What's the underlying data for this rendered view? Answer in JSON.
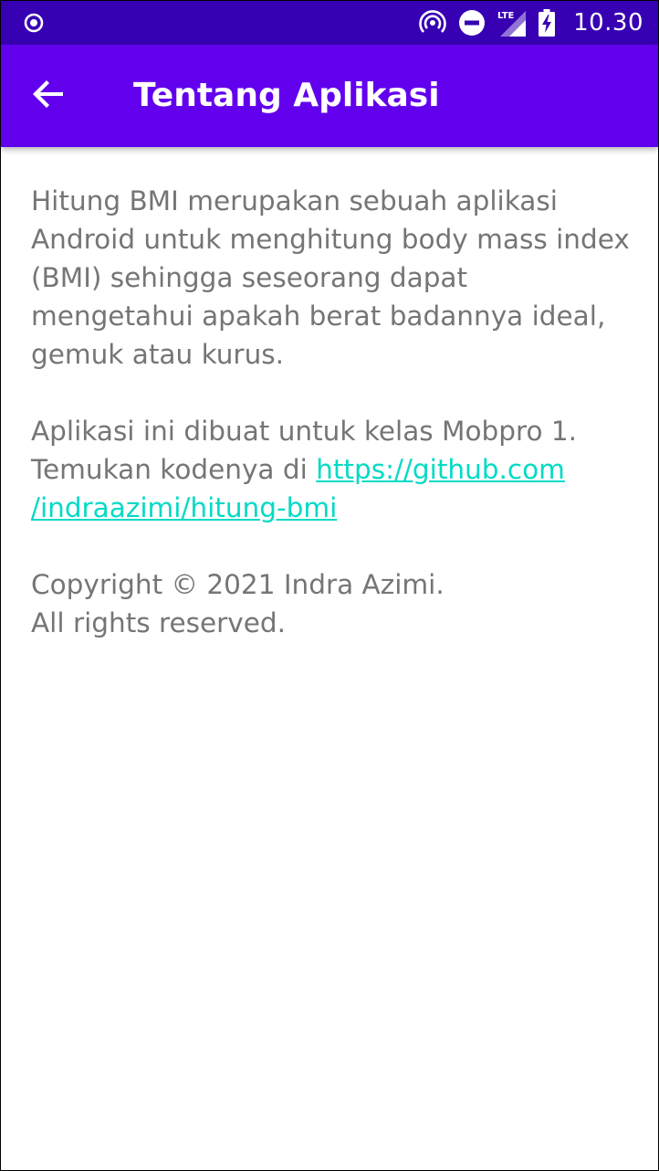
{
  "status_bar": {
    "time": "10.30",
    "network_label": "LTE",
    "icons": [
      "sync-icon",
      "hotspot-icon",
      "do-not-disturb-icon",
      "lte-signal-icon",
      "battery-charging-icon"
    ],
    "background": "#3700b3"
  },
  "app_bar": {
    "title": "Tentang Aplikasi",
    "back_icon": "arrow-back-icon",
    "background": "#6200ee"
  },
  "content": {
    "paragraph1": "Hitung BMI merupakan sebuah aplikasi Android untuk menghitung body mass index (BMI) sehingga seseorang dapat mengetahui apakah berat badannya ideal, gemuk atau kurus.",
    "paragraph2_line1": "Aplikasi ini dibuat untuk kelas Mobpro 1.",
    "paragraph2_prefix": "Temukan kodenya di ",
    "link_line1": "https://github.com",
    "link_line2": "/indraazimi/hitung-bmi",
    "copyright_line1": "Copyright © 2021 Indra Azimi.",
    "copyright_line2": "All rights reserved.",
    "text_color": "#757575",
    "link_color": "#03dac5"
  }
}
